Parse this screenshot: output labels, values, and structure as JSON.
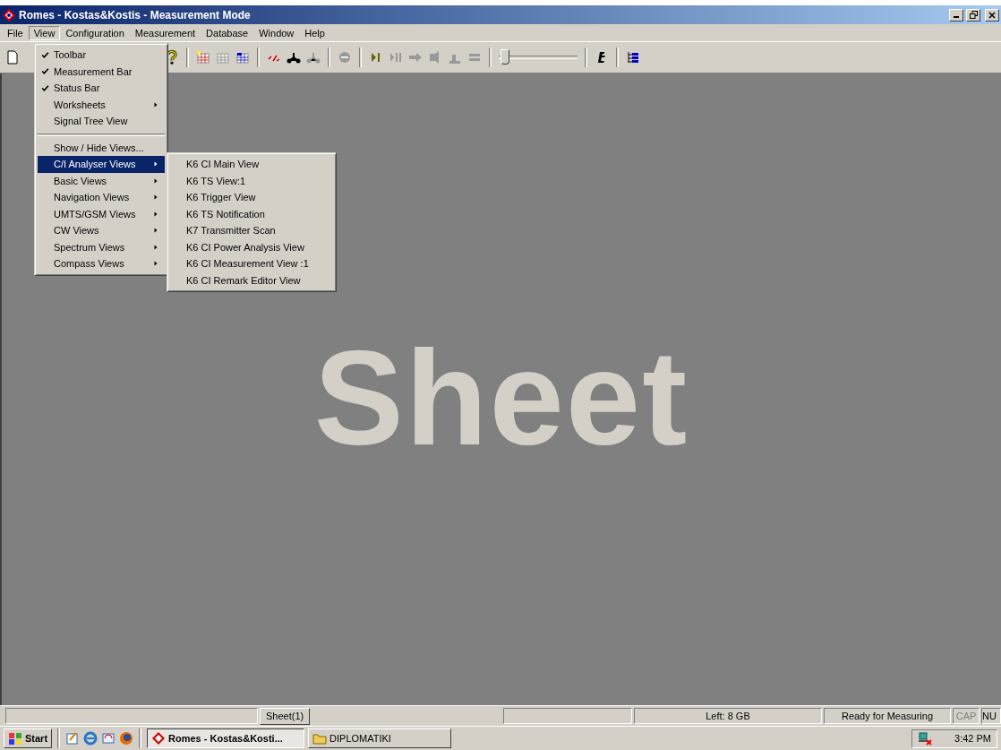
{
  "window": {
    "title": "Romes - Kostas&Kostis - Measurement Mode"
  },
  "menu_bar": [
    {
      "label": "File",
      "selected": false
    },
    {
      "label": "View",
      "selected": true
    },
    {
      "label": "Configuration",
      "selected": false
    },
    {
      "label": "Measurement",
      "selected": false
    },
    {
      "label": "Database",
      "selected": false
    },
    {
      "label": "Window",
      "selected": false
    },
    {
      "label": "Help",
      "selected": false
    }
  ],
  "view_menu": [
    {
      "kind": "item",
      "label": "Toolbar",
      "checked": true,
      "submenu": false,
      "selected": false
    },
    {
      "kind": "item",
      "label": "Measurement Bar",
      "checked": true,
      "submenu": false,
      "selected": false
    },
    {
      "kind": "item",
      "label": "Status Bar",
      "checked": true,
      "submenu": false,
      "selected": false
    },
    {
      "kind": "item",
      "label": "Worksheets",
      "checked": false,
      "submenu": true,
      "selected": false
    },
    {
      "kind": "item",
      "label": "Signal Tree View",
      "checked": false,
      "submenu": false,
      "selected": false
    },
    {
      "kind": "separator"
    },
    {
      "kind": "item",
      "label": "Show / Hide Views...",
      "checked": false,
      "submenu": false,
      "selected": false
    },
    {
      "kind": "item",
      "label": "C/I Analyser Views",
      "checked": false,
      "submenu": true,
      "selected": true
    },
    {
      "kind": "item",
      "label": "Basic Views",
      "checked": false,
      "submenu": true,
      "selected": false
    },
    {
      "kind": "item",
      "label": "Navigation Views",
      "checked": false,
      "submenu": true,
      "selected": false
    },
    {
      "kind": "item",
      "label": "UMTS/GSM Views",
      "checked": false,
      "submenu": true,
      "selected": false
    },
    {
      "kind": "item",
      "label": "CW Views",
      "checked": false,
      "submenu": true,
      "selected": false
    },
    {
      "kind": "item",
      "label": "Spectrum Views",
      "checked": false,
      "submenu": true,
      "selected": false
    },
    {
      "kind": "item",
      "label": "Compass Views",
      "checked": false,
      "submenu": true,
      "selected": false
    }
  ],
  "submenu": [
    {
      "label": "K6 CI Main View"
    },
    {
      "label": "K6 TS View:1"
    },
    {
      "label": "K6 Trigger View"
    },
    {
      "label": "K6 TS Notification"
    },
    {
      "label": "K7 Transmitter Scan"
    },
    {
      "label": "K6 CI Power Analysis View"
    },
    {
      "label": "K6 CI Measurement View :1"
    },
    {
      "label": "K6 CI Remark Editor View"
    }
  ],
  "toolbar": {
    "slider": {
      "level": 0.02
    }
  },
  "workspace": {
    "watermark": "Sheet"
  },
  "sheet_tab": "Sheet(1)",
  "status_bar": [
    {
      "text": "Left: 8 GB",
      "disabled": false
    },
    {
      "text": "Ready for Measuring",
      "disabled": false
    },
    {
      "text": "CAP",
      "disabled": true
    },
    {
      "text": "NU",
      "disabled": false
    }
  ],
  "taskbar": {
    "start": "Start",
    "tasks": [
      {
        "label": "Romes - Kostas&Kosti...",
        "selected": true,
        "kind": "app"
      },
      {
        "label": "DIPLOMATIKI",
        "selected": false,
        "kind": "folder"
      }
    ],
    "clock": "3:42 PM"
  }
}
